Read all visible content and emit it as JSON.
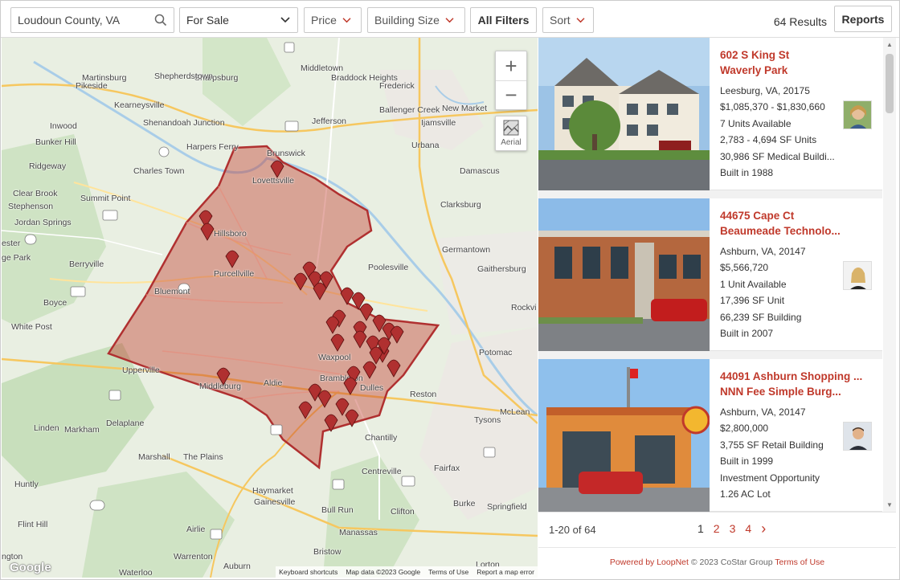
{
  "toolbar": {
    "search_value": "Loudoun County, VA",
    "listing_type": "For Sale",
    "price_label": "Price",
    "building_size_label": "Building Size",
    "all_filters_label": "All Filters",
    "sort_label": "Sort",
    "results_text": "64 Results",
    "reports_label": "Reports"
  },
  "map": {
    "labels": [
      "Martinsburg",
      "Sharpsburg",
      "Middletown",
      "Shepherdstown",
      "Braddock Heights",
      "Frederick",
      "Pikeside",
      "Kearneysville",
      "Ballenger Creek",
      "New Market",
      "Shenandoah Junction",
      "Jefferson",
      "Ijamsville",
      "Inwood",
      "Bunker Hill",
      "Harpers Ferry",
      "Brunswick",
      "Urbana",
      "Ridgeway",
      "Charles Town",
      "Lovettsville",
      "Damascus",
      "Clear Brook",
      "Summit Point",
      "Stephenson",
      "Clarksburg",
      "Jordan Springs",
      "Hillsboro",
      "Germantown",
      "ester",
      "ge Park",
      "Berryville",
      "Purcellville",
      "Poolesville",
      "Gaithersburg",
      "Bluemont",
      "Boyce",
      "Rockvi",
      "White Post",
      "Waxpool",
      "Potomac",
      "Upperville",
      "Aldie",
      "Middleburg",
      "Brambleton",
      "Dulles",
      "Reston",
      "McLean",
      "Tysons",
      "Linden",
      "Markham",
      "Delaplane",
      "Chantilly",
      "Marshall",
      "The Plains",
      "Centreville",
      "Fairfax",
      "Huntly",
      "Haymarket",
      "Gainesville",
      "Burke",
      "Springfield",
      "Bull Run",
      "Clifton",
      "Flint Hill",
      "Airlie",
      "Manassas",
      "Warrenton",
      "Auburn",
      "Bristow",
      "Lorton",
      "Waterloo",
      "ngton"
    ],
    "aerial_label": "Aerial",
    "google_label": "Google",
    "attribution": [
      "Keyboard shortcuts",
      "Map data ©2023 Google",
      "Terms of Use",
      "Report a map error"
    ],
    "zoom_in": "+",
    "zoom_out": "−",
    "county_fill": "#c0392b",
    "marker_color": "#b03030"
  },
  "listings": [
    {
      "title1": "602 S King St",
      "title2": "Waverly Park",
      "lines": [
        "Leesburg, VA, 20175",
        "$1,085,370 - $1,830,660",
        "7 Units Available",
        "2,783 - 4,694 SF Units",
        "30,986 SF Medical Buildi...",
        "Built in 1988"
      ]
    },
    {
      "title1": "44675 Cape Ct",
      "title2": "Beaumeade Technolo...",
      "lines": [
        "Ashburn, VA, 20147",
        "$5,566,720",
        "1 Unit Available",
        "17,396 SF Unit",
        "66,239 SF Building",
        "Built in 2007"
      ]
    },
    {
      "title1": "44091 Ashburn Shopping ...",
      "title2": "NNN Fee Simple Burg...",
      "lines": [
        "Ashburn, VA, 20147",
        "$2,800,000",
        "3,755 SF Retail Building",
        "Built in 1999",
        "Investment Opportunity",
        "1.26 AC Lot"
      ]
    }
  ],
  "pager": {
    "count": "1-20 of 64",
    "pages": [
      "1",
      "2",
      "3",
      "4"
    ],
    "next": "›"
  },
  "footer": {
    "powered": "Powered by LoopNet",
    "copyright": " © 2023 CoStar Group ",
    "terms": "Terms of Use"
  },
  "colors": {
    "accent": "#c0392b"
  }
}
